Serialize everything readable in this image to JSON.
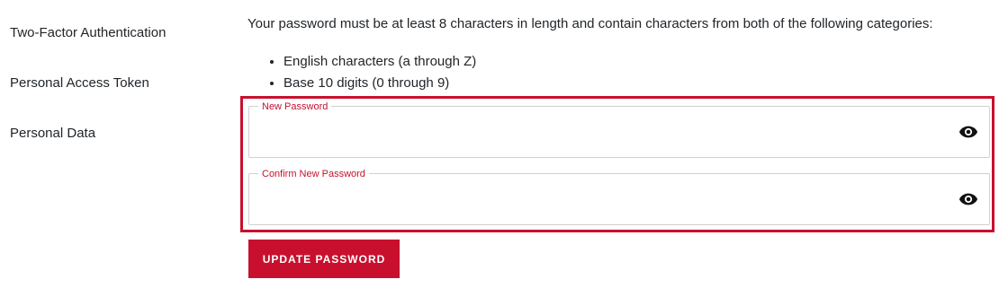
{
  "sidebar": {
    "items": [
      {
        "label": "Two-Factor Authentication"
      },
      {
        "label": "Personal Access Token"
      },
      {
        "label": "Personal Data"
      }
    ]
  },
  "password": {
    "intro": "Your password must be at least 8 characters in length and contain characters from both of the following categories:",
    "rules": [
      "English characters (a through Z)",
      "Base 10 digits (0 through 9)"
    ],
    "new_password_label": "New Password",
    "new_password_value": "",
    "confirm_password_label": "Confirm New Password",
    "confirm_password_value": "",
    "visibility_icon": "eye-icon",
    "update_button_label": "UPDATE PASSWORD"
  },
  "colors": {
    "accent": "#c8102e",
    "text": "#212529",
    "field_border": "#d0d0d0"
  }
}
